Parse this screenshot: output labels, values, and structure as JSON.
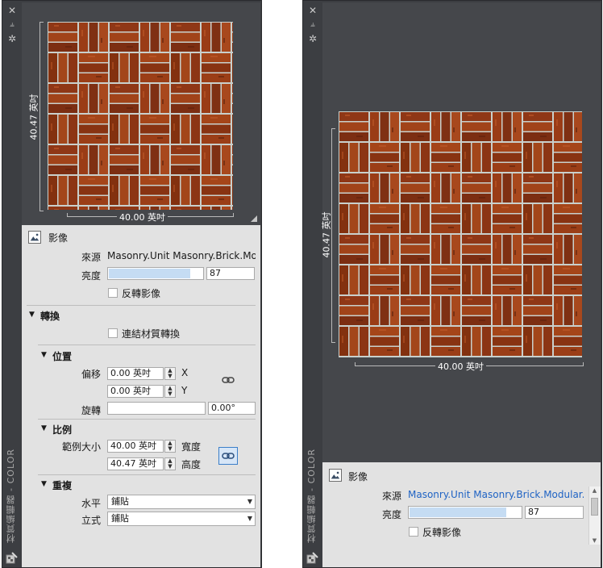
{
  "left_panel": {
    "vertical_title": "材質編輯器 - COLOR",
    "preview": {
      "width_label": "40.00 英吋",
      "height_label": "40.47 英吋"
    },
    "image_section": {
      "title": "影像",
      "source_label": "來源",
      "source_value": "Masonry.Unit Masonry.Brick.Modular.B",
      "brightness_label": "亮度",
      "brightness_value": "87",
      "brightness_fraction": 0.87,
      "invert_label": "反轉影像"
    },
    "transform_section": {
      "title": "轉換",
      "link_label": "連結材質轉換",
      "position": {
        "title": "位置",
        "offset_label": "偏移",
        "offset_x": "0.00 英吋",
        "offset_y": "0.00 英吋",
        "x_label": "X",
        "y_label": "Y",
        "rotation_label": "旋轉",
        "rotation_value": "0.00°"
      },
      "scale": {
        "title": "比例",
        "sample_size_label": "範例大小",
        "width_value": "40.00 英吋",
        "height_value": "40.47 英吋",
        "width_label": "寬度",
        "height_label": "高度"
      },
      "repeat": {
        "title": "重複",
        "horizontal_label": "水平",
        "horizontal_value": "鋪貼",
        "vertical_label": "立式",
        "vertical_value": "鋪貼"
      }
    }
  },
  "right_panel": {
    "vertical_title": "材質編輯器 - COLOR",
    "preview": {
      "width_label": "40.00 英吋",
      "height_label": "40.47 英吋"
    },
    "image_section": {
      "title": "影像",
      "source_label": "來源",
      "source_value": "Masonry.Unit Masonry.Brick.Modular.B",
      "brightness_label": "亮度",
      "brightness_value": "87",
      "brightness_fraction": 0.87,
      "invert_label": "反轉影像"
    }
  },
  "colors": {
    "link": "#1f63c4",
    "panel_dark": "#3c3e42",
    "props_bg": "#e2e2e2",
    "brick": "#8a3414",
    "mortar": "#cfd6d3"
  }
}
